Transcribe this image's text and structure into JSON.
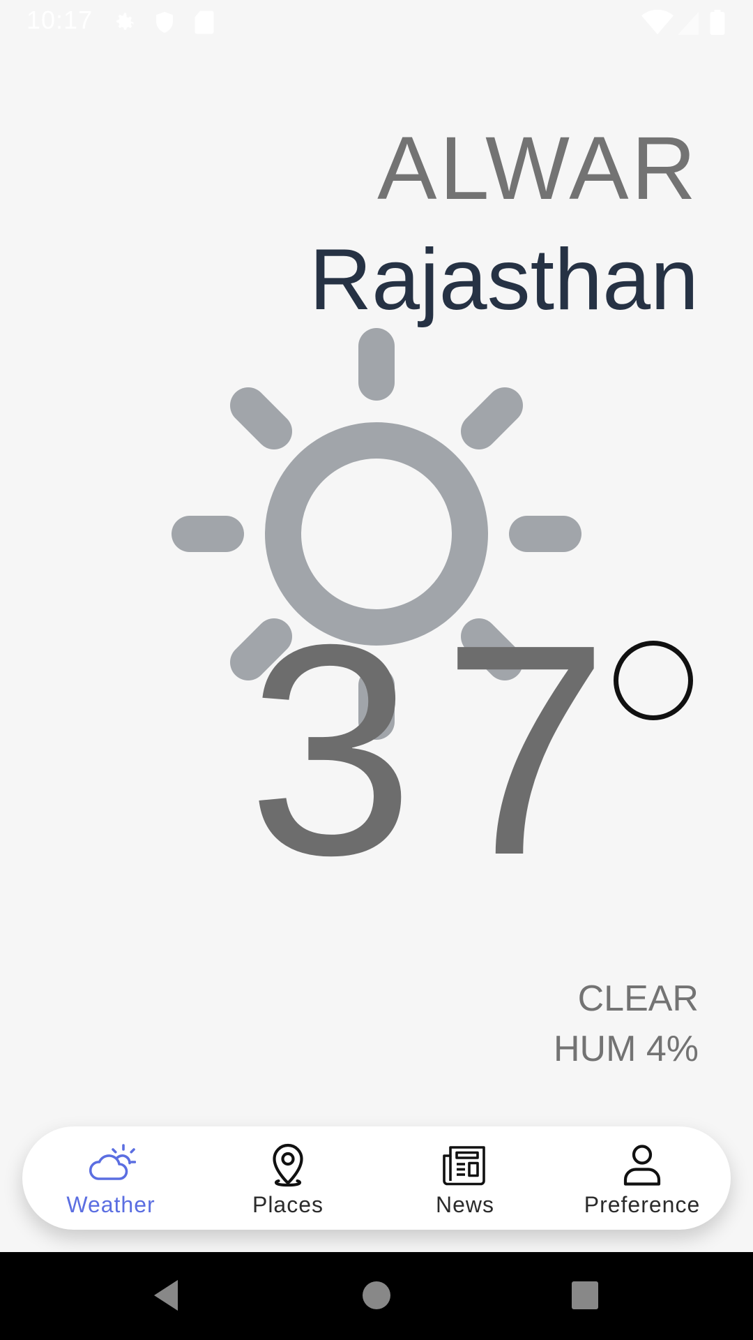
{
  "status_bar": {
    "time": "10:17",
    "icons": [
      "settings-icon",
      "shield-icon",
      "sd-card-icon",
      "wifi-icon",
      "signal-icon",
      "battery-icon"
    ]
  },
  "location": {
    "city": "ALWAR",
    "region": "Rajasthan"
  },
  "weather": {
    "icon": "sun-icon",
    "temperature": "37",
    "unit_icon": "degree-circle",
    "condition": "CLEAR",
    "humidity": "HUM 4%"
  },
  "nav": {
    "items": [
      {
        "label": "Weather",
        "icon": "weather-icon",
        "active": true
      },
      {
        "label": "Places",
        "icon": "location-pin-icon",
        "active": false
      },
      {
        "label": "News",
        "icon": "newspaper-icon",
        "active": false
      },
      {
        "label": "Preference",
        "icon": "person-icon",
        "active": false
      }
    ]
  },
  "colors": {
    "background": "#f6f6f6",
    "accent": "#5b6ee1",
    "city_text": "#737373",
    "region_text": "#263244",
    "sun": "#a1a5aa",
    "temperature": "#6d6d6d"
  }
}
